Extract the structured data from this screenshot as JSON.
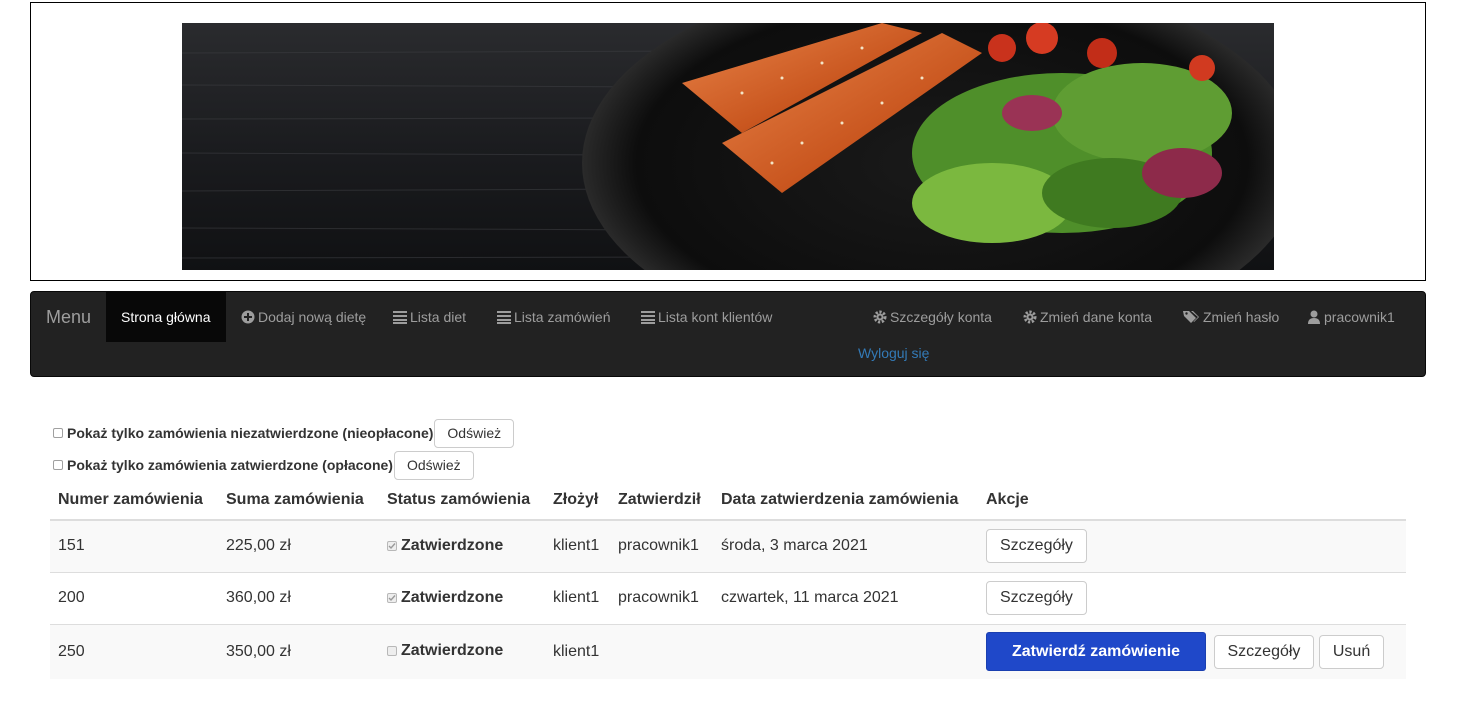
{
  "navbar": {
    "brand": "Menu",
    "items": [
      {
        "label": "Strona główna",
        "icon": "none",
        "active": true
      },
      {
        "label": "Dodaj nową dietę",
        "icon": "plus-circle-icon"
      },
      {
        "label": "Lista diet",
        "icon": "list-icon"
      },
      {
        "label": "Lista zamówień",
        "icon": "list-icon"
      },
      {
        "label": "Lista kont klientów",
        "icon": "list-icon"
      }
    ],
    "right_items": [
      {
        "label": "Szczegóły konta",
        "icon": "gear-icon"
      },
      {
        "label": "Zmień dane konta",
        "icon": "gear-icon"
      },
      {
        "label": "Zmień hasło",
        "icon": "tags-icon"
      },
      {
        "label": "pracownik1",
        "icon": "user-icon"
      }
    ],
    "logout": "Wyloguj się"
  },
  "filters": [
    {
      "label": "Pokaż tylko zamówienia niezatwierdzone (nieopłacone)",
      "checked": false,
      "button": "Odśwież"
    },
    {
      "label": "Pokaż tylko zamówienia zatwierdzone (opłacone)",
      "checked": false,
      "button": "Odśwież"
    }
  ],
  "table": {
    "headers": [
      "Numer zamówienia",
      "Suma zamówienia",
      "Status zamówienia",
      "Złożył",
      "Zatwierdził",
      "Data zatwierdzenia zamówienia",
      "Akcje"
    ],
    "rows": [
      {
        "number": "151",
        "sum": "225,00 zł",
        "status": "Zatwierdzone",
        "status_checked": true,
        "placed_by": "klient1",
        "approved_by": "pracownik1",
        "approval_date": "środa, 3 marca 2021",
        "actions": [
          "Szczegóły"
        ]
      },
      {
        "number": "200",
        "sum": "360,00 zł",
        "status": "Zatwierdzone",
        "status_checked": true,
        "placed_by": "klient1",
        "approved_by": "pracownik1",
        "approval_date": "czwartek, 11 marca 2021",
        "actions": [
          "Szczegóły"
        ]
      },
      {
        "number": "250",
        "sum": "350,00 zł",
        "status": "Zatwierdzone",
        "status_checked": false,
        "placed_by": "klient1",
        "approved_by": "",
        "approval_date": "",
        "actions": [
          "Zatwierdź zamówienie",
          "Szczegóły",
          "Usuń"
        ]
      }
    ]
  },
  "colors": {
    "navbar_bg": "#222222",
    "nav_text": "#9d9d9d",
    "link": "#337ab7",
    "primary_button": "#1f48c9"
  }
}
